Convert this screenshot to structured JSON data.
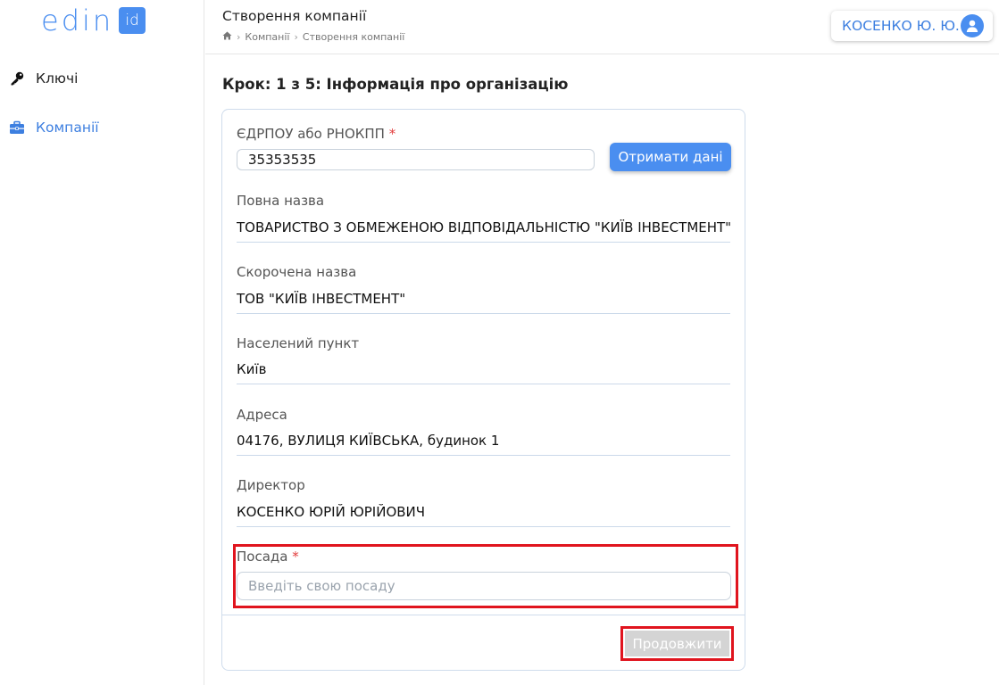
{
  "logo": {
    "text": "edin",
    "badge": "id"
  },
  "sidebar": {
    "items": [
      {
        "label": "Ключі",
        "icon": "key-icon"
      },
      {
        "label": "Компанії",
        "icon": "briefcase-icon",
        "active": true
      }
    ]
  },
  "header": {
    "title": "Створення компанії",
    "breadcrumb": [
      "Компанії",
      "Створення компанії"
    ],
    "user_name": "КОСЕНКО Ю. Ю."
  },
  "step_title": "Крок: 1 з 5: Інформація про організацію",
  "form": {
    "edrpou": {
      "label": "ЄДРПОУ або РНОКПП",
      "required_mark": "*",
      "value": "35353535",
      "button": "Отримати дані"
    },
    "full_name": {
      "label": "Повна назва",
      "value": "ТОВАРИСТВО З ОБМЕЖЕНОЮ ВІДПОВІДАЛЬНІСТЮ \"КИЇВ ІНВЕСТМЕНТ\""
    },
    "short_name": {
      "label": "Скорочена назва",
      "value": "ТОВ \"КИЇВ ІНВЕСТМЕНТ\""
    },
    "city": {
      "label": "Населений пункт",
      "value": "Київ"
    },
    "address": {
      "label": "Адреса",
      "value": "04176, ВУЛИЦЯ КИЇВСЬКА, будинок 1"
    },
    "director": {
      "label": "Директор",
      "value": "КОСЕНКО ЮРІЙ ЮРІЙОВИЧ"
    },
    "position": {
      "label": "Посада",
      "required_mark": "*",
      "placeholder": "Введіть свою посаду",
      "value": ""
    },
    "continue_button": "Продовжити"
  },
  "colors": {
    "accent": "#4a8ef0",
    "highlight": "#e0141e",
    "required": "#e23b3b"
  }
}
